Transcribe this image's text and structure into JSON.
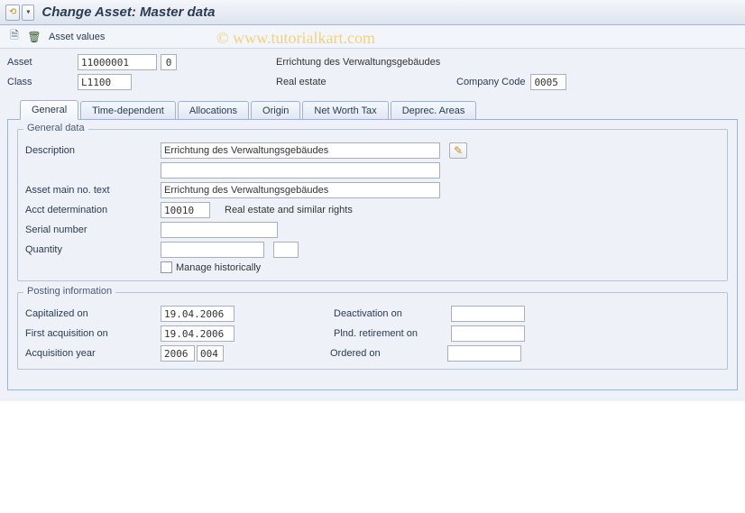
{
  "title": "Change Asset:  Master data",
  "toolbar2": {
    "asset_values_label": "Asset values"
  },
  "watermark": "© www.tutorialkart.com",
  "header": {
    "asset_label": "Asset",
    "asset_value": "11000001",
    "asset_sub": "0",
    "asset_text": "Errichtung des Verwaltungsgebäudes",
    "class_label": "Class",
    "class_value": "L1100",
    "class_text": "Real estate",
    "company_code_label": "Company Code",
    "company_code_value": "0005"
  },
  "tabs": [
    {
      "label": "General"
    },
    {
      "label": "Time-dependent"
    },
    {
      "label": "Allocations"
    },
    {
      "label": "Origin"
    },
    {
      "label": "Net Worth Tax"
    },
    {
      "label": "Deprec. Areas"
    }
  ],
  "general": {
    "group_title": "General data",
    "description_label": "Description",
    "description_value": "Errichtung des Verwaltungsgebäudes",
    "description_value2": "",
    "asset_main_label": "Asset main no. text",
    "asset_main_value": "Errichtung des Verwaltungsgebäudes",
    "acct_det_label": "Acct determination",
    "acct_det_value": "10010",
    "acct_det_text": "Real estate and similar rights",
    "serial_label": "Serial number",
    "serial_value": "",
    "qty_label": "Quantity",
    "qty_value": "",
    "qty_unit": "",
    "manage_hist_label": "Manage historically"
  },
  "posting": {
    "group_title": "Posting information",
    "cap_on_label": "Capitalized on",
    "cap_on_value": "19.04.2006",
    "first_acq_label": "First acquisition on",
    "first_acq_value": "19.04.2006",
    "acq_year_label": "Acquisition year",
    "acq_year_value": "2006",
    "acq_period_value": "004",
    "deact_label": "Deactivation on",
    "deact_value": "",
    "plnd_ret_label": "Plnd. retirement on",
    "plnd_ret_value": "",
    "ordered_label": "Ordered on",
    "ordered_value": ""
  }
}
